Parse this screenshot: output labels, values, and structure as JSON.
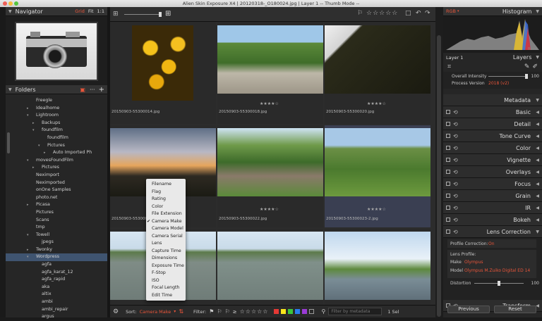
{
  "window": {
    "title": "Alien Skin Exposure X4 | 20120318-_O180024.jpg | Layer 1 -- Thumb Mode --"
  },
  "navigator": {
    "title": "Navigator",
    "grid": "Grid",
    "fit": "Fit",
    "one": "1:1"
  },
  "folders": {
    "title": "Folders",
    "items": [
      {
        "label": "Freegle",
        "depth": 0,
        "arrow": ""
      },
      {
        "label": "Idealhome",
        "depth": 0,
        "arrow": "▸"
      },
      {
        "label": "Lightroom",
        "depth": 0,
        "arrow": "▾"
      },
      {
        "label": "Backups",
        "depth": 1,
        "arrow": "▸"
      },
      {
        "label": "foundfilm",
        "depth": 1,
        "arrow": "▾"
      },
      {
        "label": "foundfilm",
        "depth": 2,
        "arrow": ""
      },
      {
        "label": "Pictures",
        "depth": 2,
        "arrow": "▾"
      },
      {
        "label": "Auto Imported Ph",
        "depth": 3,
        "arrow": "▸"
      },
      {
        "label": "movesFoundFilm",
        "depth": 0,
        "arrow": "▾"
      },
      {
        "label": "Pictures",
        "depth": 1,
        "arrow": "▸"
      },
      {
        "label": "Neximport",
        "depth": 0,
        "arrow": ""
      },
      {
        "label": "Neximported",
        "depth": 0,
        "arrow": ""
      },
      {
        "label": "onOne Samples",
        "depth": 0,
        "arrow": ""
      },
      {
        "label": "photo.net",
        "depth": 0,
        "arrow": ""
      },
      {
        "label": "Picasa",
        "depth": 0,
        "arrow": "▸"
      },
      {
        "label": "Pictures",
        "depth": 0,
        "arrow": ""
      },
      {
        "label": "Scans",
        "depth": 0,
        "arrow": ""
      },
      {
        "label": "tmp",
        "depth": 0,
        "arrow": ""
      },
      {
        "label": "Towell",
        "depth": 0,
        "arrow": "▾"
      },
      {
        "label": "jpegs",
        "depth": 1,
        "arrow": ""
      },
      {
        "label": "Twonky",
        "depth": 0,
        "arrow": "▸"
      },
      {
        "label": "Wordpress",
        "depth": 0,
        "arrow": "▾",
        "selected": true
      },
      {
        "label": "agfa",
        "depth": 1,
        "arrow": ""
      },
      {
        "label": "agfa_karat_12",
        "depth": 1,
        "arrow": ""
      },
      {
        "label": "agfa_rapid",
        "depth": 1,
        "arrow": ""
      },
      {
        "label": "aka",
        "depth": 1,
        "arrow": ""
      },
      {
        "label": "altix",
        "depth": 1,
        "arrow": ""
      },
      {
        "label": "ambi",
        "depth": 1,
        "arrow": ""
      },
      {
        "label": "ambi_repair",
        "depth": 1,
        "arrow": ""
      },
      {
        "label": "argus",
        "depth": 1,
        "arrow": ""
      }
    ]
  },
  "grid": {
    "cells": [
      {
        "caption": "20150903-55300014.jpg",
        "stars": "",
        "thumb": "flowers"
      },
      {
        "caption": "20150903-55300018.jpg",
        "stars": "★★★★☆",
        "thumb": "garden"
      },
      {
        "caption": "20150903-55300020.jpg",
        "stars": "★★★★☆",
        "thumb": "dark"
      },
      {
        "caption": "20150903-5530002",
        "stars": "",
        "thumb": "sunset"
      },
      {
        "caption": "20150903-55300022.jpg",
        "stars": "★★★★☆",
        "thumb": "park"
      },
      {
        "caption": "20150903-55300023-2.jpg",
        "stars": "★★★★☆",
        "thumb": "tent"
      },
      {
        "caption": "",
        "stars": "",
        "thumb": "river"
      },
      {
        "caption": "",
        "stars": "",
        "thumb": "river2"
      },
      {
        "caption": "",
        "stars": "",
        "thumb": "river3"
      }
    ]
  },
  "bottombar": {
    "sort_label": "Sort:",
    "sort_value": "Camera Make",
    "filter_label": "Filter:",
    "search_placeholder": "Filter by metadata",
    "page_label": "1 Sel"
  },
  "sort_menu": {
    "items": [
      "Filename",
      "Flag",
      "Rating",
      "Color",
      "File Extension",
      "Camera Make",
      "Camera Model",
      "Camera Serial",
      "Lens",
      "Capture Time",
      "Dimensions",
      "Exposure Time",
      "F-Stop",
      "ISO",
      "Focal Length",
      "Edit Time"
    ],
    "checked": "Camera Make"
  },
  "histogram": {
    "title": "Histogram",
    "mode": "RGB",
    "reset": "Reset"
  },
  "layers": {
    "name": "Layer 1",
    "title": "Layers",
    "intensity_label": "Overall Intensity",
    "intensity_value": "100",
    "intensity_level": 1.0,
    "version_label": "Process Version",
    "version_value": "2018 (v2)"
  },
  "adjust": {
    "metadata": "Metadata",
    "panels": [
      "Basic",
      "Detail",
      "Tone Curve",
      "Color",
      "Vignette",
      "Overlays",
      "Focus",
      "Grain",
      "IR",
      "Bokeh",
      "Lens Correction"
    ],
    "transform": "Transform"
  },
  "lens": {
    "profile_correction_label": "Profile Correction:",
    "profile_correction_value": "On",
    "lens_profile_label": "Lens Profile:",
    "make_label": "Make",
    "make_value": "Olympus",
    "model_label": "Model",
    "model_value": "Olympus M.Zuiko Digital ED 14",
    "distortion_label": "Distortion",
    "distortion_value": "100",
    "distortion_level": 1.0
  },
  "buttons": {
    "previous": "Previous",
    "reset": "Reset"
  },
  "colors": {
    "accent": "#e8553a",
    "selection": "#3f5470",
    "label_colors": [
      "#e53935",
      "#f9e51c",
      "#3cc63c",
      "#2a7bef",
      "#9b3bd6",
      "#8a8a8a"
    ]
  }
}
